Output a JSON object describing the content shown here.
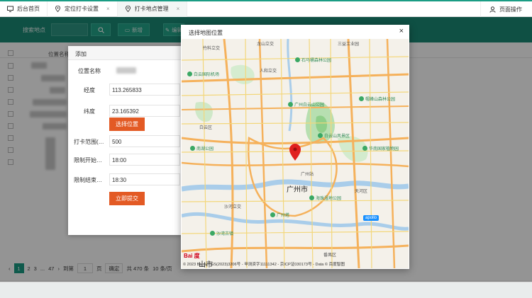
{
  "topbar": {
    "tabs": [
      {
        "label": "后台首页",
        "icon": "monitor-icon"
      },
      {
        "label": "定位打卡设置",
        "icon": "location-pin-icon"
      },
      {
        "label": "打卡地点管理",
        "icon": "location-pin-icon"
      }
    ],
    "close_glyph": "×",
    "page_ops": "页面操作"
  },
  "toolbar": {
    "search_label": "搜索地点",
    "add_label": "新增",
    "edit_label": "编辑"
  },
  "grid": {
    "column_header": "位置名称"
  },
  "pager": {
    "prev": "‹",
    "pages": [
      "1",
      "2",
      "3",
      "...",
      "47"
    ],
    "next": "›",
    "goto_label": "到第",
    "goto_value": "1",
    "page_unit": "页",
    "confirm": "确定",
    "total": "共 470 条",
    "page_size": "10 条/页"
  },
  "add_dialog": {
    "title": "添加",
    "fields": [
      {
        "label": "位置名称",
        "value": ""
      },
      {
        "label": "经度",
        "value": "113.265833"
      },
      {
        "label": "纬度",
        "value": "23.165392"
      },
      {
        "label": "打卡范围(…",
        "value": "500"
      },
      {
        "label": "限制开始…",
        "value": "18:00"
      },
      {
        "label": "限制结束…",
        "value": "18:30"
      }
    ],
    "select_location_button": "选择位置",
    "submit_button": "立即提交"
  },
  "map_dialog": {
    "title": "选择地图位置",
    "close_glyph": "×",
    "city_label": "广州市",
    "labels": [
      "龙山立交",
      "三益工业园",
      "竹料立交",
      "人和立交",
      "白云区",
      "沙河立交",
      "天河区",
      "番禺区",
      "广州站",
      "山市"
    ],
    "pois": [
      "白云国际机场",
      "石马桶森林公园",
      "帽峰山森林公园",
      "广州白云山公园",
      "白云山风景区",
      "南湖公园",
      "华南国家植物园",
      "海珠湿地公园",
      "广州塔",
      "沙湾古镇"
    ],
    "copyright": "© 2023 Baidu - GS(2023)3206号 - 甲测资字11111342 - 京ICP证030173号 - Data © 百度智图",
    "baidu_logo": "Bai 度",
    "apollo": "apollo"
  }
}
